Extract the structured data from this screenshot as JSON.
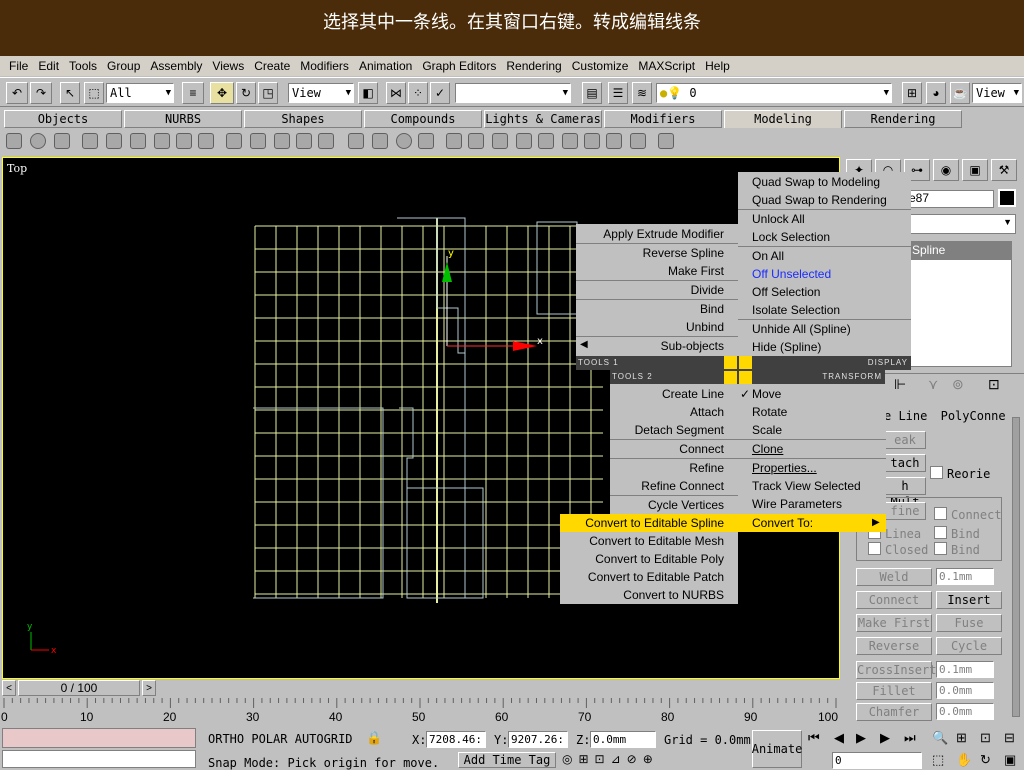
{
  "banner": {
    "text": "选择其中一条线。在其窗口右键。转成编辑线条"
  },
  "menubar": {
    "items": [
      "File",
      "Edit",
      "Tools",
      "Group",
      "Assembly",
      "Views",
      "Create",
      "Modifiers",
      "Animation",
      "Graph Editors",
      "Rendering",
      "Customize",
      "MAXScript",
      "Help"
    ]
  },
  "toolbar": {
    "selection_filter": "All",
    "ref_coord": "View",
    "named_selection": "",
    "layer_value": "0",
    "right_view": "View"
  },
  "tabs": [
    "Objects",
    "NURBS",
    "Shapes",
    "Compounds",
    "Lights & Cameras",
    "Modifiers",
    "Modeling",
    "Rendering"
  ],
  "active_tab": "Modeling",
  "viewport": {
    "label": "Top",
    "axis_x": "x",
    "axis_y": "y",
    "corner_x": "x",
    "corner_y": "y"
  },
  "quad": {
    "tools1_label": "TOOLS 1",
    "display_label": "DISPLAY",
    "tools2_label": "TOOLS 2",
    "transform_label": "TRANSFORM",
    "display_items": [
      "Quad Swap to Modeling",
      "Quad Swap to Rendering",
      "Unlock All",
      "Lock Selection",
      "On All",
      "Off Unselected",
      "Off Selection",
      "Isolate Selection",
      "Unhide All (Spline)",
      "Hide (Spline)"
    ],
    "tools1_items": [
      "Apply Extrude Modifier",
      "Reverse Spline",
      "Make First",
      "Divide",
      "Bind",
      "Unbind",
      "Sub-objects"
    ],
    "tools2_items": [
      "Create Line",
      "Attach",
      "Detach Segment",
      "Connect",
      "Refine",
      "Refine Connect",
      "Cycle Vertices",
      "Convert to Editable Spline",
      "Convert to Editable Mesh",
      "Convert to Editable Poly",
      "Convert to Editable Patch",
      "Convert to NURBS"
    ],
    "transform_items": [
      "Move",
      "Rotate",
      "Scale",
      "Clone",
      "Properties...",
      "Track View Selected",
      "Wire Parameters",
      "Convert To:"
    ],
    "check_mark": "✓",
    "submenu_arrow": "▶",
    "left_arrow": "◀"
  },
  "cmdpanel": {
    "name_value": "e87",
    "stack_item": "Spline",
    "new_vertex_type": "e Line",
    "polyconn": "PolyConne",
    "break_btn": "eak",
    "attach_btn": "tach",
    "attach_mult_btn": "h Mult",
    "reorient": "Reorie",
    "refine_btn": "fine",
    "connect_chk": "Connect",
    "linear_chk": "Linea",
    "bind1": "Bind",
    "closed_chk": "Closed",
    "bind2": "Bind",
    "weld_btn": "Weld",
    "weld_val": "0.1mm",
    "connect_btn": "Connect",
    "insert_btn": "Insert",
    "make_first_btn": "Make First",
    "fuse_btn": "Fuse",
    "reverse_btn": "Reverse",
    "cycle_btn": "Cycle",
    "crossinsert_btn": "CrossInsert",
    "crossinsert_val": "0.1mm",
    "fillet_btn": "Fillet",
    "fillet_val": "0.0mm",
    "chamfer_btn": "Chamfer",
    "chamfer_val": "0.0mm"
  },
  "timeslider": {
    "frame": "0 / 100",
    "prev": "<",
    "next": ">"
  },
  "ruler": {
    "ticks": [
      "0",
      "10",
      "20",
      "30",
      "40",
      "50",
      "60",
      "70",
      "80",
      "90",
      "100"
    ]
  },
  "status": {
    "ortho": "ORTHO",
    "polar": "POLAR",
    "autogrid": "AUTOGRID",
    "x_label": "X:",
    "x_val": "7208.46:",
    "y_label": "Y:",
    "y_val": "9207.26:",
    "z_label": "Z:",
    "z_val": "0.0mm",
    "grid": "Grid = 0.0mm",
    "prompt": "Snap Mode: Pick origin for move.",
    "add_time_tag": "Add Time Tag",
    "animate": "Animate",
    "frame_val": "0"
  }
}
